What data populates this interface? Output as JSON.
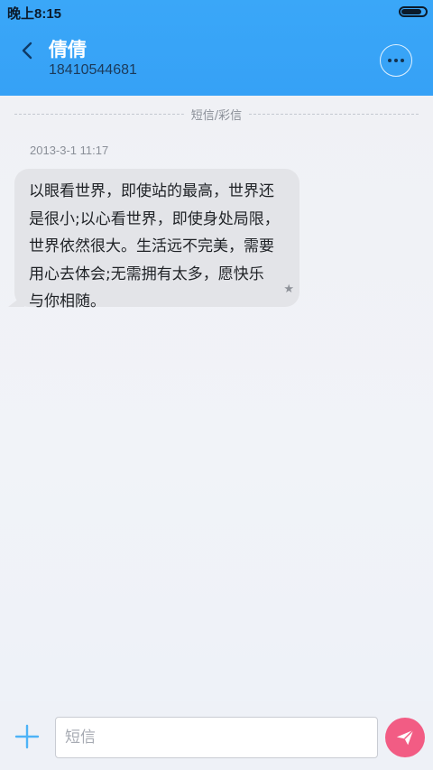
{
  "status_bar": {
    "time": "晚上8:15",
    "battery_level": 0.85
  },
  "header": {
    "back_icon": "chevron-left-icon",
    "contact_name": "倩倩",
    "contact_number": "18410544681",
    "more_icon": "more-horizontal-icon"
  },
  "conversation": {
    "divider_label": "短信/彩信",
    "messages": [
      {
        "time": "2013-3-1 11:17",
        "lines": [
          "以眼看世界，即使站的最高，世界还",
          "是很小;以心看世界，即使身处局限，",
          "世界依然很大。生活远不完美，需要",
          "用心去体会;无需拥有太多，愿快乐",
          "与你相随。"
        ],
        "star": "★"
      }
    ]
  },
  "composer": {
    "add_icon": "plus-icon",
    "placeholder": "短信",
    "value": "",
    "send_icon": "send-icon"
  },
  "colors": {
    "header_bg": "#38a4f7",
    "bubble_bg": "#e3e4e8",
    "send_button": "#f25c84",
    "accent_blue": "#4db3f7"
  }
}
